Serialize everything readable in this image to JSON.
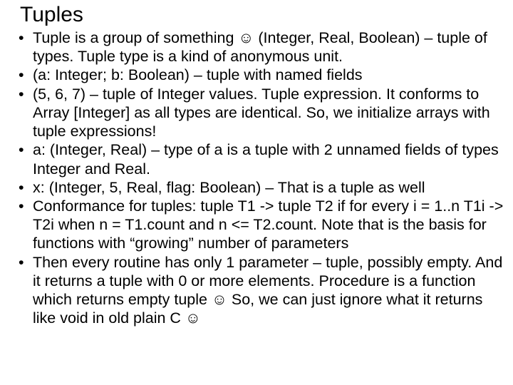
{
  "title": "Tuples",
  "bullets": [
    "Tuple is a group of something ☺ (Integer, Real, Boolean) – tuple of types. Tuple type is a kind of anonymous unit.",
    "(a: Integer; b: Boolean) – tuple with named fields",
    "(5, 6, 7) – tuple of Integer values. Tuple expression. It conforms to Array [Integer] as all types are identical. So, we initialize arrays with tuple expressions!",
    "a: (Integer, Real) – type of a is a tuple with 2 unnamed fields of types Integer and Real.",
    "x: (Integer, 5, Real, flag: Boolean) – That is a tuple as well",
    "Conformance for tuples: tuple T1 -> tuple T2 if for every i = 1..n T1i -> T2i when n = T1.count and n <= T2.count. Note that is the basis for functions with “growing” number of parameters",
    "Then every routine has only 1 parameter – tuple, possibly empty. And it returns a tuple with 0 or more elements. Procedure is a function which returns empty tuple ☺ So, we can just ignore what it returns like void in old plain C ☺"
  ]
}
